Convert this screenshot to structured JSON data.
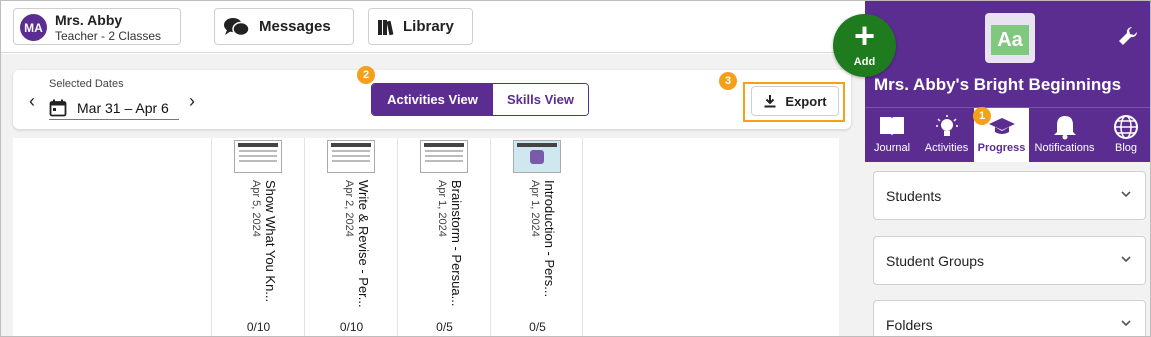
{
  "user": {
    "initials": "MA",
    "name": "Mrs. Abby",
    "role": "Teacher - 2 Classes"
  },
  "topnav": {
    "messages": "Messages",
    "library": "Library"
  },
  "toolbar": {
    "selected_dates_label": "Selected Dates",
    "date_range": "Mar 31 – Apr 6",
    "activities_view": "Activities View",
    "skills_view": "Skills View",
    "export": "Export",
    "badge_view": "2",
    "badge_export": "3"
  },
  "activities": [
    {
      "title": "Show What You Kn...",
      "date": "Apr 5, 2024",
      "score": "0/10"
    },
    {
      "title": "Write & Revise - Per...",
      "date": "Apr 2, 2024",
      "score": "0/10"
    },
    {
      "title": "Brainstorm - Persua...",
      "date": "Apr 1, 2024",
      "score": "0/5"
    },
    {
      "title": "Introduction - Pers...",
      "date": "Apr 1, 2024",
      "score": "0/5"
    }
  ],
  "fab": {
    "symbol": "+",
    "label": "Add"
  },
  "panel": {
    "school_name": "Mrs. Abby's Bright Beginnings",
    "logo_text": "Aa",
    "tabs": [
      {
        "label": "Journal",
        "icon": "book-icon"
      },
      {
        "label": "Activities",
        "icon": "lightbulb-icon"
      },
      {
        "label": "Progress",
        "icon": "graduation-cap-icon",
        "active": true
      },
      {
        "label": "Notifications",
        "icon": "bell-icon"
      },
      {
        "label": "Blog",
        "icon": "globe-icon"
      }
    ],
    "badge_progress": "1",
    "sections": [
      "Students",
      "Student Groups",
      "Folders"
    ]
  },
  "colors": {
    "brand": "#5b2d91",
    "accent": "#f5a01a",
    "add": "#1e7b1e"
  }
}
